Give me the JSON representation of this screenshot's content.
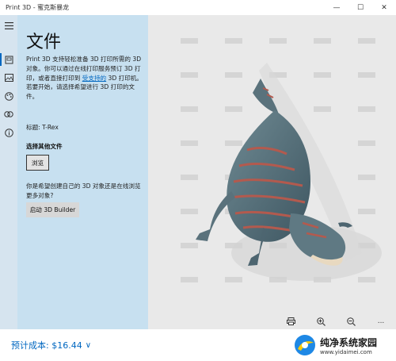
{
  "window": {
    "title": "Print 3D - 蜜克斯暴龙",
    "minimize": "—",
    "maximize": "☐",
    "close": "✕"
  },
  "rail": {
    "icons": [
      "hamburger-menu-icon",
      "print-icon",
      "image-icon",
      "palette-icon",
      "model-icon",
      "info-icon"
    ]
  },
  "pane": {
    "heading": "文件",
    "description_1": "Print 3D 支持轻松准备 3D 打印所需的 3D 对象。你可以通过在线打印服务预订 3D 打印，或者直接打印到",
    "supported_link": "受支持的",
    "description_2": " 3D 打印机。若要开始，请选择希望进行 3D 打印的文件。",
    "title_line": "标题: T-Rex",
    "choose_other": "选择其他文件",
    "browse_button": "浏览",
    "question": "你是希望创建自己的 3D 对象还是在线浏览更多对象?",
    "launch_3d_builder": "启动 3D Builder"
  },
  "viewport_toolbar": {
    "icons": [
      "print-settings-icon",
      "zoom-in-icon",
      "zoom-out-icon",
      "more-icon"
    ],
    "more_label": "..."
  },
  "cost": {
    "label": "预计成本: $16.44",
    "chevron": "∨"
  },
  "watermark": {
    "line1": "纯净系统家园",
    "line2": "www.yidaimei.com"
  },
  "colors": {
    "accent": "#0067c0",
    "pane_bg": "#c7e0f0",
    "viewport_bg": "#e9e9e9"
  }
}
